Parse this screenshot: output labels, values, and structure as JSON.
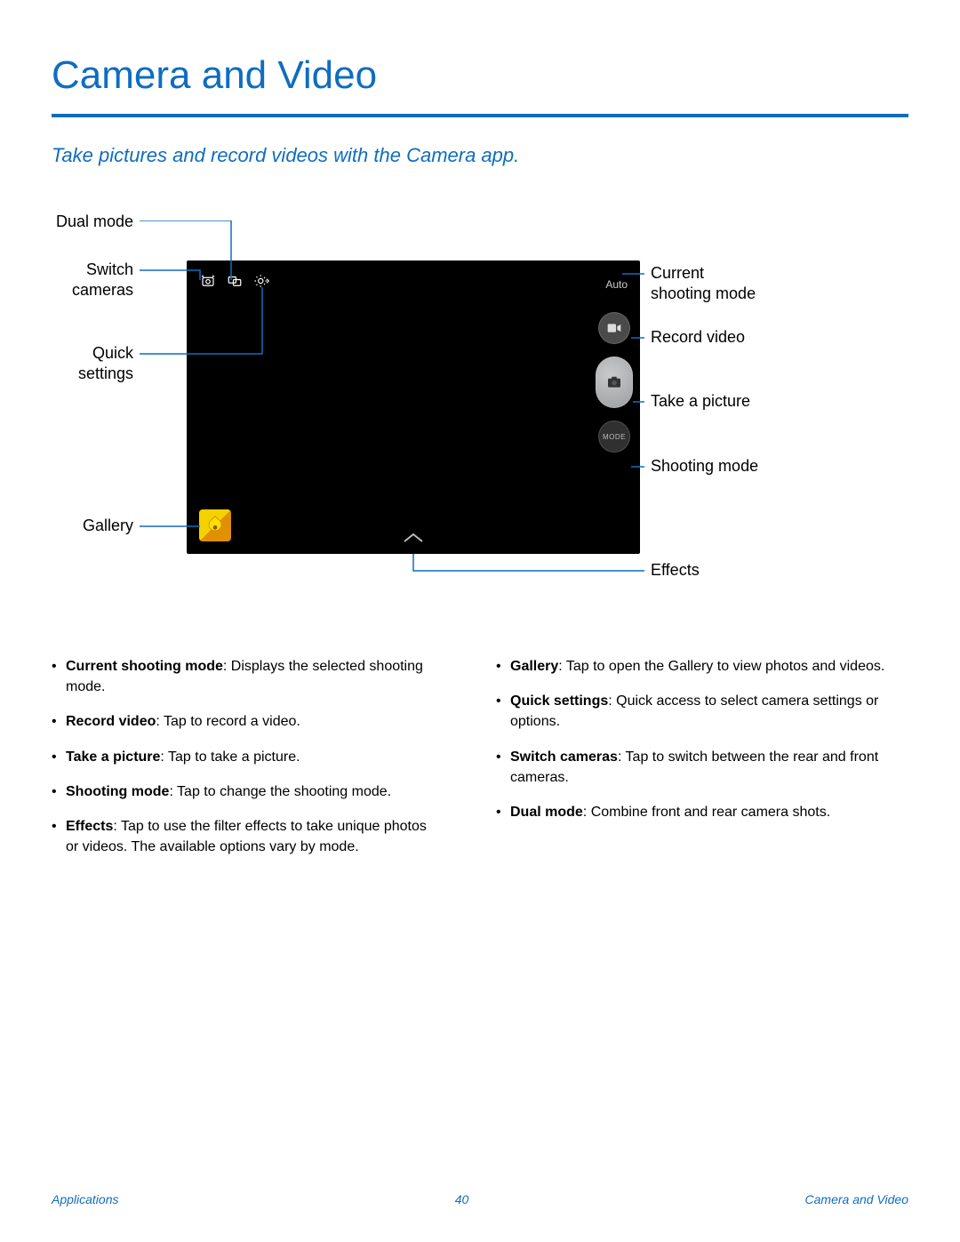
{
  "title": "Camera and Video",
  "subtitle": "Take pictures and record videos with the Camera app.",
  "labels": {
    "dual_mode": "Dual mode",
    "switch_cameras": "Switch\ncameras",
    "quick_settings": "Quick\nsettings",
    "gallery": "Gallery",
    "current_mode": "Current\nshooting mode",
    "record_video": "Record video",
    "take_picture": "Take a picture",
    "shooting_mode": "Shooting mode",
    "effects": "Effects"
  },
  "camera": {
    "auto_label": "Auto",
    "mode_btn_label": "MODE"
  },
  "bullets": {
    "left": [
      {
        "term": "Current shooting mode",
        "desc": ": Displays the selected shooting mode."
      },
      {
        "term": "Record video",
        "desc": ": Tap to record a video."
      },
      {
        "term": "Take a picture",
        "desc": ": Tap to take a picture."
      },
      {
        "term": "Shooting mode",
        "desc": ": Tap to change the shooting mode."
      },
      {
        "term": "Effects",
        "desc": ": Tap to use the filter effects to take unique photos or videos. The available options vary by mode."
      }
    ],
    "right": [
      {
        "term": "Gallery",
        "desc": ": Tap to open the Gallery to view photos and videos."
      },
      {
        "term": "Quick settings",
        "desc": ": Quick access to select camera settings or options."
      },
      {
        "term": "Switch cameras",
        "desc": ": Tap to switch between the rear and front cameras."
      },
      {
        "term": "Dual mode",
        "desc": ": Combine front and rear camera shots."
      }
    ]
  },
  "footer": {
    "left": "Applications",
    "center": "40",
    "right": "Camera and Video"
  }
}
